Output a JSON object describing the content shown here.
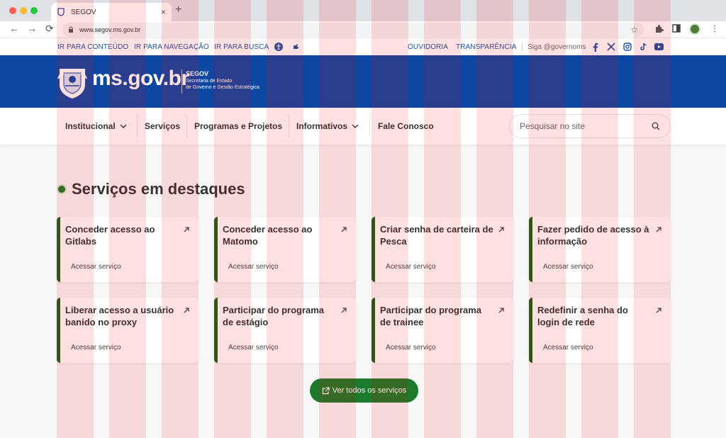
{
  "browser": {
    "tab_title": "SEGOV",
    "url": "www.segov.ms.gov.br"
  },
  "utility": {
    "links": [
      "IR PARA CONTEÚDO",
      "IR PARA NAVEGAÇÃO",
      "IR PARA BUSCA"
    ],
    "ouvidoria": "OUVIDORIA",
    "transparencia": "TRANSPARÊNCIA",
    "siga": "Siga @governoms"
  },
  "header": {
    "logo_text": "ms.gov.br",
    "org_name": "SEGOV",
    "org_line1": "Secretaria de Estado",
    "org_line2": "de Governo e Gestão Estratégica"
  },
  "nav": {
    "items": [
      "Institucional",
      "Serviços",
      "Programas e Projetos",
      "Informativos",
      "Fale Conosco"
    ],
    "search_placeholder": "Pesquisar no site"
  },
  "section": {
    "title": "Serviços em destaques",
    "link_label": "Acessar serviço",
    "cards": [
      {
        "title": "Conceder acesso ao Gitlabs"
      },
      {
        "title": "Conceder acesso ao Matomo"
      },
      {
        "title": "Criar senha de carteira de Pesca"
      },
      {
        "title": "Fazer pedido de acesso à informação"
      },
      {
        "title": "Liberar acesso a usuário banido no proxy"
      },
      {
        "title": "Participar do programa de estágio"
      },
      {
        "title": "Participar do programa de trainee"
      },
      {
        "title": "Redefinir a senha do login de rede"
      }
    ],
    "all_button": "Ver todos os serviços"
  },
  "colors": {
    "primary_blue": "#0d47a1",
    "accent_green": "#1b7a2c",
    "card_border_green": "#1b5e20",
    "link_blue": "#1d4fa5"
  },
  "icons": {
    "social": [
      "facebook-icon",
      "x-twitter-icon",
      "instagram-icon",
      "tiktok-icon",
      "youtube-icon"
    ]
  }
}
